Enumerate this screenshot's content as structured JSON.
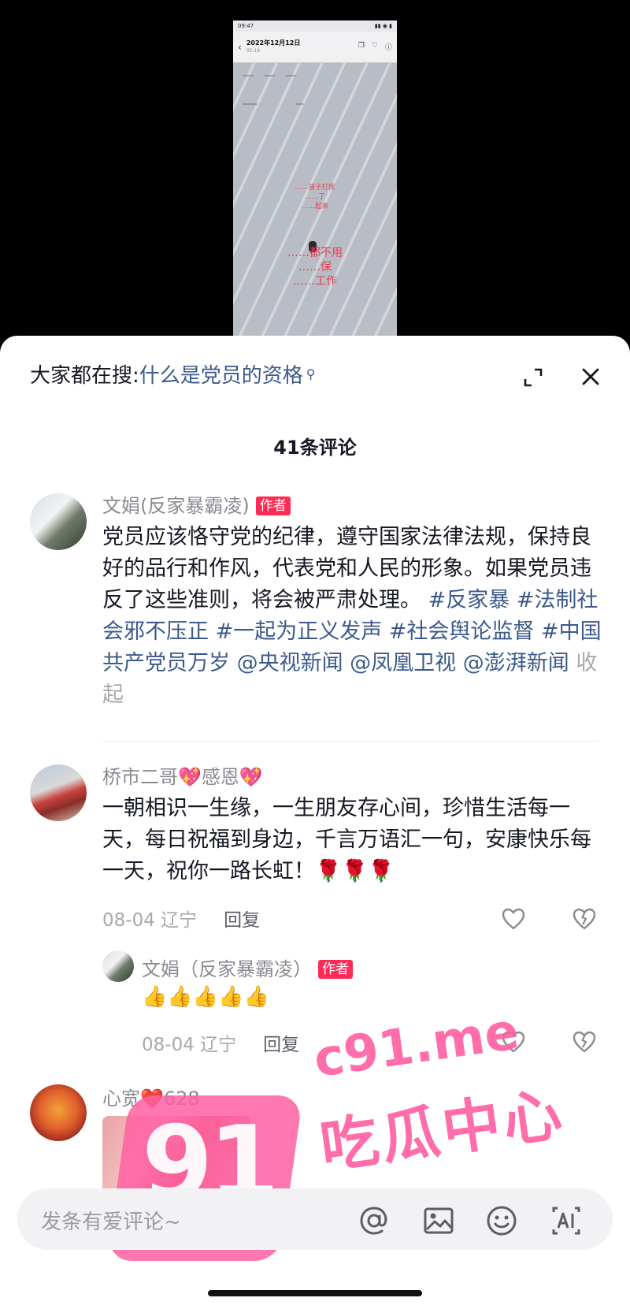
{
  "video": {
    "status_time": "09:47",
    "header_date": "2022年12月12日",
    "header_time": "05:19",
    "red_text_small": [
      "……孩子打疾",
      "……了",
      "……起来"
    ],
    "red_text_big": [
      "……都不用",
      "……保",
      "……工作"
    ]
  },
  "search": {
    "prefix": "大家都在搜:",
    "term": "什么是党员的资格"
  },
  "comments_count": "41条评论",
  "comments": [
    {
      "username": "文娟(反家暴霸凌)",
      "author_badge": "作者",
      "text": "党员应该恪守党的纪律，遵守国家法律法规，保持良好的品行和作风，代表党和人民的形象。如果党员违反了这些准则，将会被严肃处理。",
      "tags": "#反家暴 #法制社会邪不压正 #一起为正义发声 #社会舆论监督 #中国共产党员万岁 @央视新闻 @凤凰卫视 @澎湃新闻",
      "collapse": "收起"
    },
    {
      "username": "桥市二哥💖感恩💖",
      "text": "一朝相识一生缘，一生朋友存心间，珍惜生活每一天，每日祝福到身边，千言万语汇一句，安康快乐每一天，祝你一路长虹！🌹🌹🌹",
      "date": "08-04 辽宁",
      "reply_label": "回复"
    },
    {
      "username": "文娟（反家暴霸凌）",
      "author_badge": "作者",
      "text": "👍👍👍👍👍",
      "date": "08-04 辽宁",
      "reply_label": "回复"
    },
    {
      "username": "心宽❤️628"
    }
  ],
  "watermark": {
    "number": "91",
    "url": "c91.me",
    "name": "吃瓜中心"
  },
  "input": {
    "placeholder": "发条有爱评论~"
  },
  "colors": {
    "accent_red": "#fe2c55",
    "link_blue": "#3c5a8a",
    "watermark_pink": "#ff5fa2"
  }
}
